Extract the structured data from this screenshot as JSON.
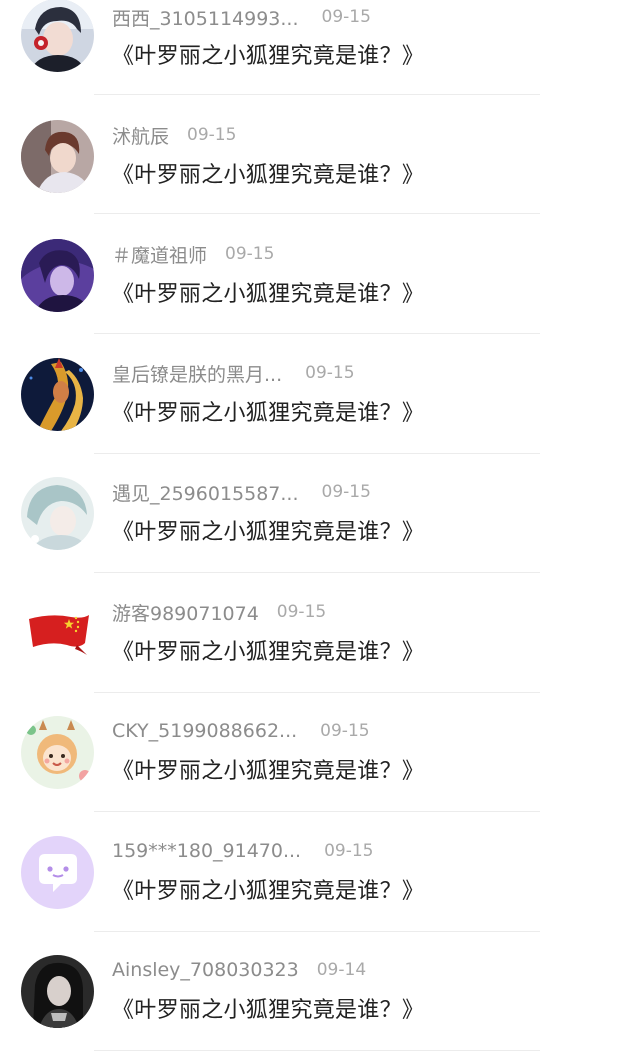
{
  "comments": [
    {
      "username": "西西_3105114993...",
      "date": "09-15",
      "text": "《叶罗丽之小狐狸究竟是谁？》",
      "avatar_icon": "anime-boy-headphones-avatar"
    },
    {
      "username": "沭航辰",
      "date": "09-15",
      "text": "《叶罗丽之小狐狸究竟是谁？》",
      "avatar_icon": "anime-boy-photo-avatar"
    },
    {
      "username": "＃魔道祖师",
      "date": "09-15",
      "text": "《叶罗丽之小狐狸究竟是谁？》",
      "avatar_icon": "purple-anime-avatar"
    },
    {
      "username": "皇后镣是朕的黑月...",
      "date": "09-15",
      "text": "《叶罗丽之小狐狸究竟是谁？》",
      "avatar_icon": "golden-hair-warrior-avatar"
    },
    {
      "username": "遇见_2596015587...",
      "date": "09-15",
      "text": "《叶罗丽之小狐狸究竟是谁？》",
      "avatar_icon": "pale-anime-avatar"
    },
    {
      "username": "游客989071074",
      "date": "09-15",
      "text": "《叶罗丽之小狐狸究竟是谁？》",
      "avatar_icon": "china-flag-avatar"
    },
    {
      "username": "CKY_5199088662...",
      "date": "09-15",
      "text": "《叶罗丽之小狐狸究竟是谁？》",
      "avatar_icon": "cartoon-deer-girl-avatar"
    },
    {
      "username": "159***180_91470...",
      "date": "09-15",
      "text": "《叶罗丽之小狐狸究竟是谁？》",
      "avatar_icon": "chat-bubble-avatar"
    },
    {
      "username": "Ainsley_708030323",
      "date": "09-14",
      "text": "《叶罗丽之小狐狸究竟是谁？》",
      "avatar_icon": "dark-photo-avatar"
    }
  ]
}
